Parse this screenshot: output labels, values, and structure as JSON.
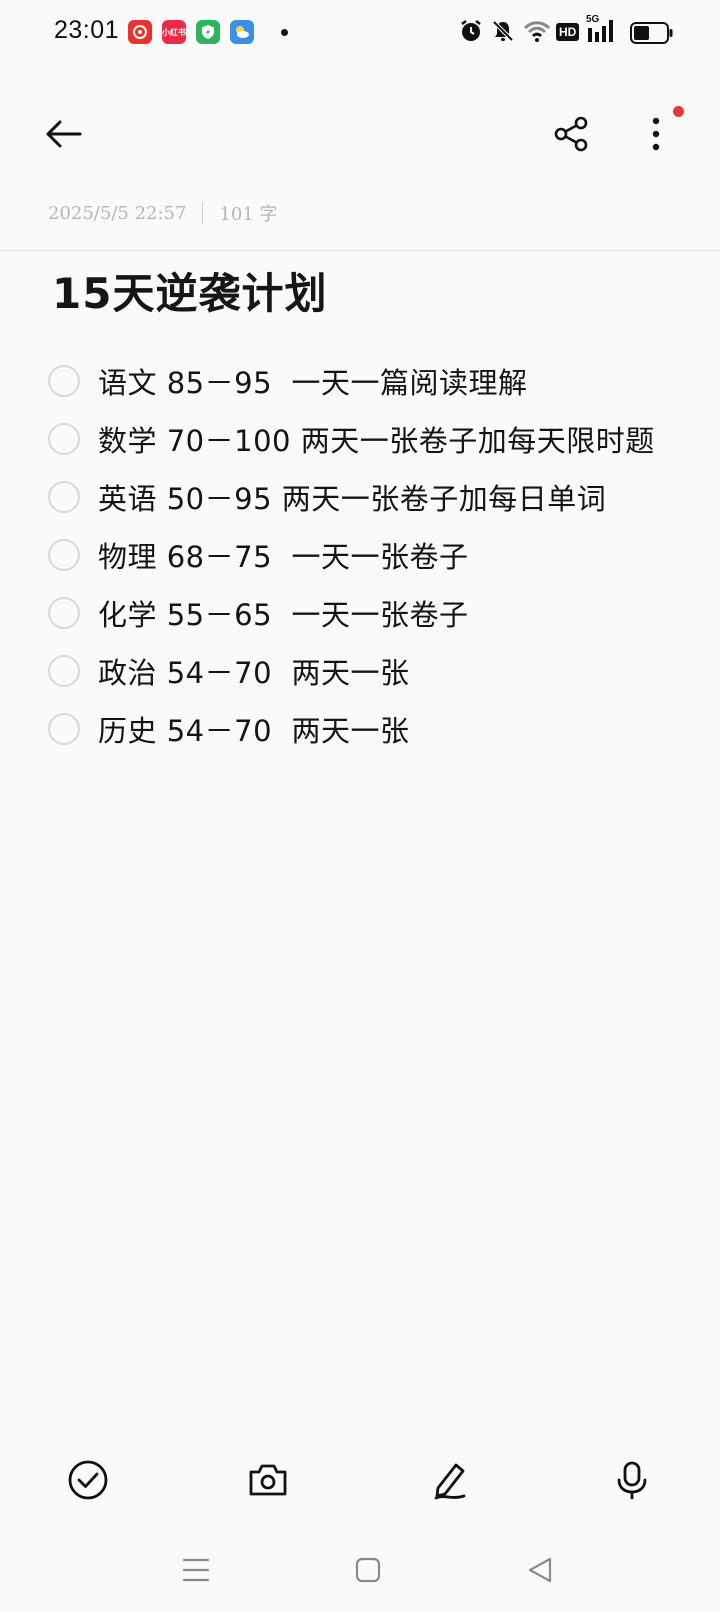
{
  "status_bar": {
    "time": "23:01",
    "app_icons": [
      {
        "name": "netease-music-icon",
        "color": "#e8322b",
        "label": ""
      },
      {
        "name": "xiaohongshu-icon",
        "color": "#ec2a45",
        "label": "小红书"
      },
      {
        "name": "security-icon",
        "color": "#2eb35a",
        "label": ""
      },
      {
        "name": "weather-icon",
        "color": "#3d8ee8",
        "label": ""
      }
    ],
    "hd_label": "HD",
    "network_label": "5G"
  },
  "note": {
    "date": "2025/5/5 22:57",
    "word_count": "101 字",
    "title": "15天逆袭计划",
    "items": [
      {
        "subject": "语文",
        "range": "85－95",
        "plan": "一天一篇阅读理解"
      },
      {
        "subject": "数学",
        "range": "70－100",
        "plan": "两天一张卷子加每天限时题"
      },
      {
        "subject": "英语",
        "range": "50－95",
        "plan": "两天一张卷子加每日单词"
      },
      {
        "subject": "物理",
        "range": "68－75",
        "plan": "一天一张卷子"
      },
      {
        "subject": "化学",
        "range": "55－65",
        "plan": "一天一张卷子"
      },
      {
        "subject": "政治",
        "range": "54－70",
        "plan": "两天一张"
      },
      {
        "subject": "历史",
        "range": "54－70",
        "plan": "两天一张"
      }
    ]
  },
  "colors": {
    "accent_red": "#e53935",
    "text": "#141414",
    "meta_gray": "#b5b5b5"
  }
}
